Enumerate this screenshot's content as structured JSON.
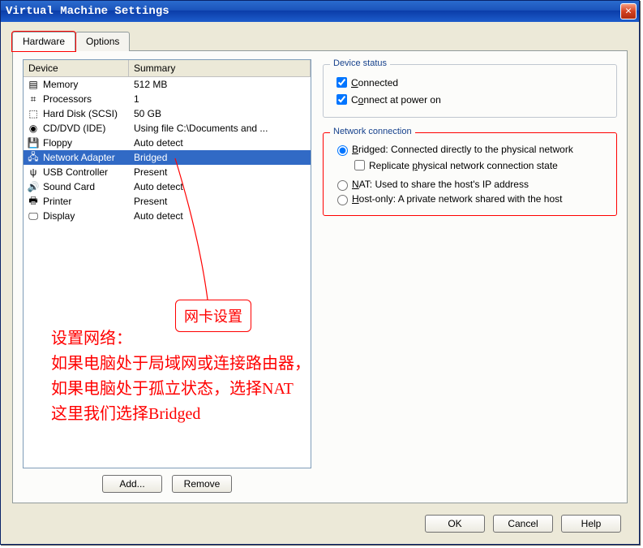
{
  "window": {
    "title": "Virtual Machine Settings",
    "tabs": [
      "Hardware",
      "Options"
    ],
    "active_tab": 0
  },
  "device_list": {
    "headers": [
      "Device",
      "Summary"
    ],
    "rows": [
      {
        "icon": "memory-icon",
        "device": "Memory",
        "summary": "512 MB"
      },
      {
        "icon": "cpu-icon",
        "device": "Processors",
        "summary": "1"
      },
      {
        "icon": "disk-icon",
        "device": "Hard Disk (SCSI)",
        "summary": "50 GB"
      },
      {
        "icon": "cd-icon",
        "device": "CD/DVD (IDE)",
        "summary": "Using file C:\\Documents and ..."
      },
      {
        "icon": "floppy-icon",
        "device": "Floppy",
        "summary": "Auto detect"
      },
      {
        "icon": "nic-icon",
        "device": "Network Adapter",
        "summary": "Bridged"
      },
      {
        "icon": "usb-icon",
        "device": "USB Controller",
        "summary": "Present"
      },
      {
        "icon": "sound-icon",
        "device": "Sound Card",
        "summary": "Auto detect"
      },
      {
        "icon": "printer-icon",
        "device": "Printer",
        "summary": "Present"
      },
      {
        "icon": "display-icon",
        "device": "Display",
        "summary": "Auto detect"
      }
    ],
    "selected_index": 5,
    "buttons": {
      "add": "Add...",
      "remove": "Remove"
    }
  },
  "device_status": {
    "legend": "Device status",
    "connected": {
      "label": "Connected",
      "checked": true
    },
    "connect_at_power_on": {
      "label": "Connect at power on",
      "checked": true
    }
  },
  "network_connection": {
    "legend": "Network connection",
    "bridged": {
      "label": "Bridged: Connected directly to the physical network",
      "selected": true
    },
    "replicate": {
      "label": "Replicate physical network connection state",
      "checked": false
    },
    "nat": {
      "label": "NAT: Used to share the host's IP address",
      "selected": false
    },
    "hostonly": {
      "label": "Host-only: A private network shared with the host",
      "selected": false
    }
  },
  "dialog_buttons": {
    "ok": "OK",
    "cancel": "Cancel",
    "help": "Help"
  },
  "annotations": {
    "callout_label": "网卡设置",
    "note_line1": "设置网络：",
    "note_line2": "如果电脑处于局域网或连接路由器，选择Bridged",
    "note_line3": "如果电脑处于孤立状态，选择NAT",
    "note_line4": "这里我们选择Bridged"
  },
  "icon_glyphs": {
    "memory-icon": "▤",
    "cpu-icon": "⌗",
    "disk-icon": "⬚",
    "cd-icon": "◉",
    "floppy-icon": "💾",
    "nic-icon": "🖧",
    "usb-icon": "ψ",
    "sound-icon": "🔊",
    "printer-icon": "🖶",
    "display-icon": "🖵"
  }
}
